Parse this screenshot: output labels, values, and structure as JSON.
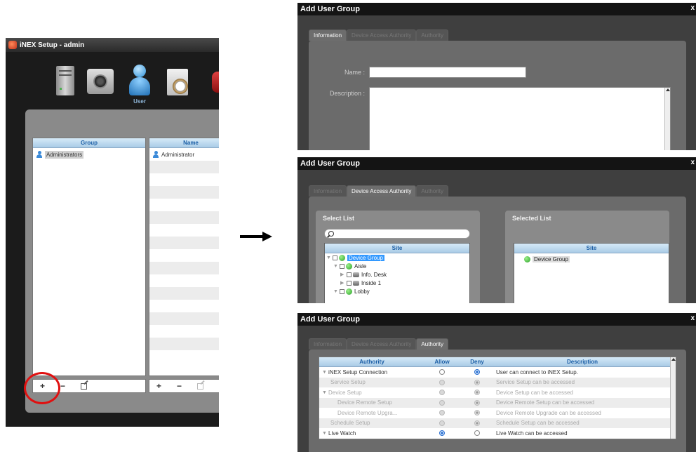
{
  "main_window": {
    "title": "iNEX Setup - admin",
    "toolbar": {
      "items": [
        {
          "icon": "server-icon"
        },
        {
          "icon": "camera-icon"
        },
        {
          "icon": "user-icon",
          "label": "User"
        },
        {
          "icon": "schedule-icon"
        },
        {
          "icon": "alarm-icon"
        }
      ]
    },
    "group_list": {
      "header": "Group",
      "rows": [
        "Administrators"
      ],
      "buttons": [
        "+",
        "−"
      ]
    },
    "user_list": {
      "header": "Name",
      "rows": [
        "Administrator"
      ],
      "buttons": [
        "+",
        "−"
      ]
    }
  },
  "dialog_information": {
    "title": "Add User Group",
    "close": "x",
    "tabs": [
      "Information",
      "Device Access Authority",
      "Authority"
    ],
    "active_tab": 0,
    "name_label": "Name :",
    "name_value": "",
    "description_label": "Description :"
  },
  "dialog_device_access": {
    "title": "Add User Group",
    "close": "x",
    "tabs": [
      "Information",
      "Device Access Authority",
      "Authority"
    ],
    "active_tab": 1,
    "select_list": {
      "title": "Select List",
      "search_placeholder": "",
      "header": "Site",
      "tree": [
        "Device Group",
        "Aisle",
        "Info. Desk",
        "Inside 1",
        "Lobby"
      ]
    },
    "selected_list": {
      "title": "Selected List",
      "header": "Site",
      "items": [
        "Device Group"
      ]
    }
  },
  "dialog_authority": {
    "title": "Add User Group",
    "close": "x",
    "tabs": [
      "Information",
      "Device Access Authority",
      "Authority"
    ],
    "active_tab": 2,
    "columns": [
      "Authority",
      "Allow",
      "Deny",
      "Description"
    ],
    "rows": [
      {
        "name": "iNEX Setup Connection",
        "allow": false,
        "deny": true,
        "enabled": true,
        "description": "User can connect to iNEX Setup."
      },
      {
        "name": "Service Setup",
        "allow": false,
        "deny": true,
        "enabled": false,
        "description": "Service Setup can be accessed"
      },
      {
        "name": "Device Setup",
        "allow": false,
        "deny": true,
        "enabled": false,
        "description": "Device Setup can be accessed"
      },
      {
        "name": "Device Remote Setup",
        "allow": false,
        "deny": true,
        "enabled": false,
        "description": "Device Remote Setup can be accessed"
      },
      {
        "name": "Device Remote Upgra...",
        "allow": false,
        "deny": true,
        "enabled": false,
        "description": "Device Remote Upgrade can be accessed"
      },
      {
        "name": "Schedule Setup",
        "allow": false,
        "deny": true,
        "enabled": false,
        "description": "Schedule Setup can be accessed"
      },
      {
        "name": "Live Watch",
        "allow": true,
        "deny": false,
        "enabled": true,
        "description": "Live Watch can be accessed"
      }
    ]
  },
  "colors": {
    "accent_blue": "#3399ff",
    "highlight_red": "#e01010",
    "header_blue_text": "#1c5fa6"
  }
}
